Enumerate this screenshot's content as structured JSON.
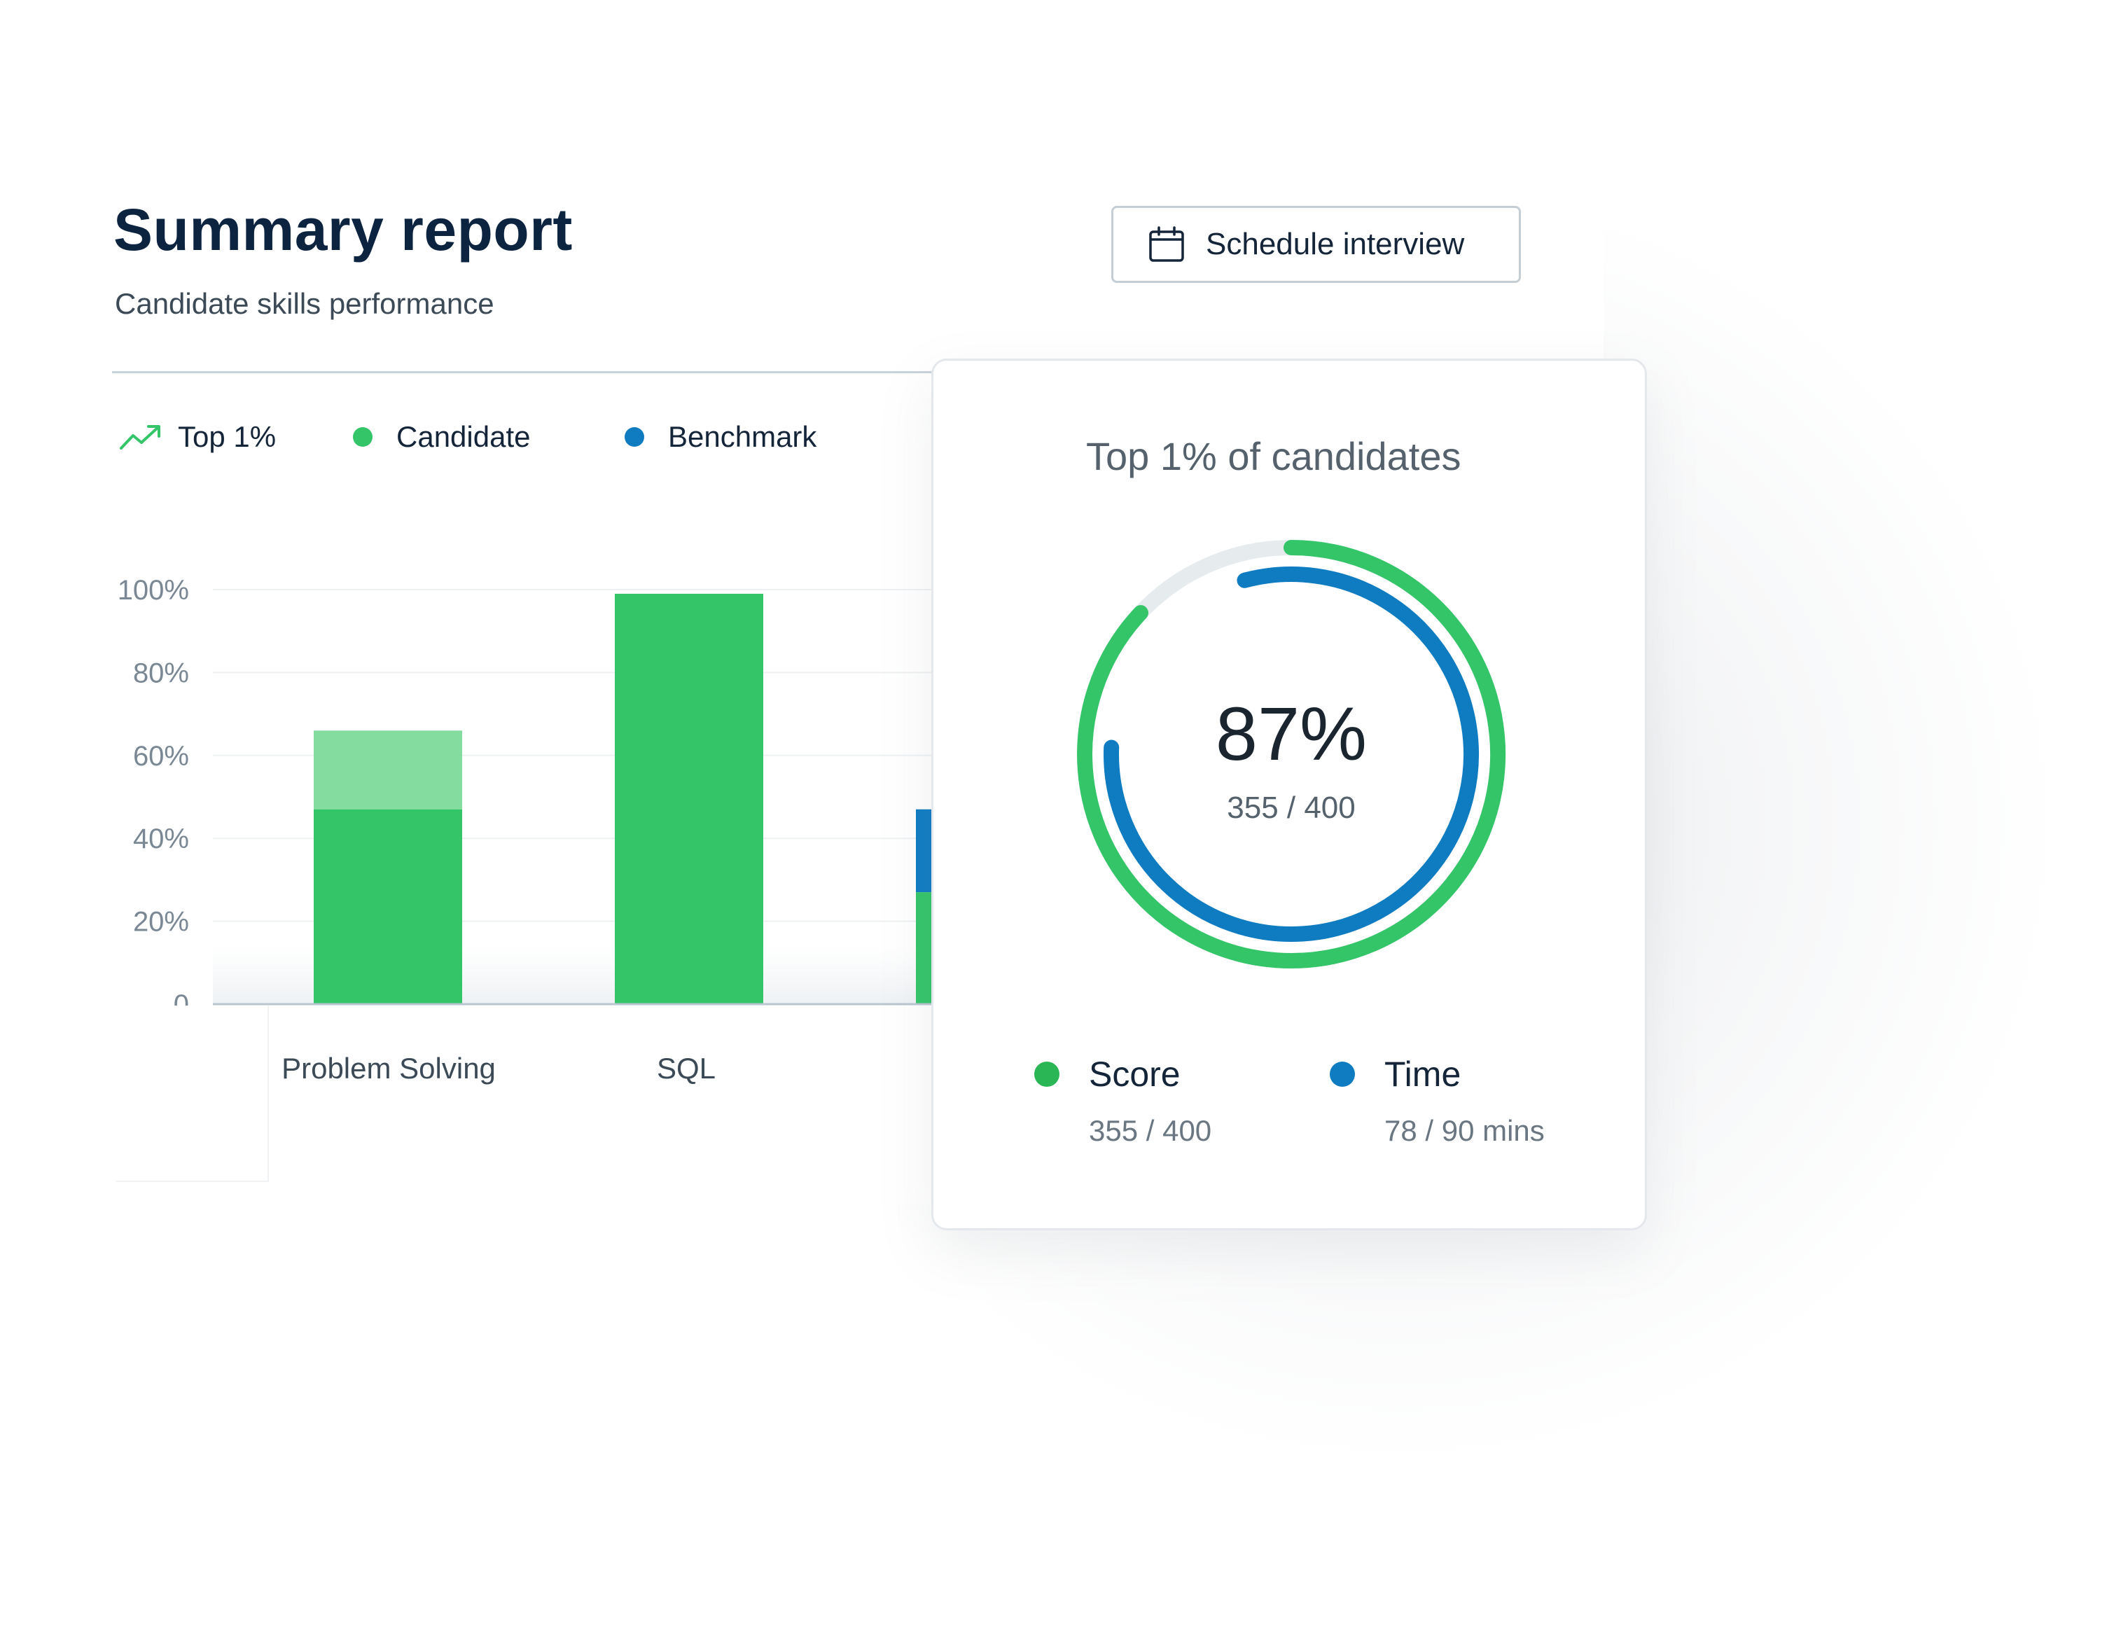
{
  "header": {
    "title": "Summary report",
    "subtitle": "Candidate skills performance",
    "schedule_button": "Schedule interview"
  },
  "legend": {
    "top_label": "Top 1%",
    "candidate_label": "Candidate",
    "benchmark_label": "Benchmark"
  },
  "colors": {
    "candidate": "#34c569",
    "candidate_light": "#84dd9f",
    "benchmark": "#0f7cc2",
    "track": "#e6ebee",
    "score_green": "#2bb656",
    "navy": "#0c2440"
  },
  "icons": {
    "trend": "trending-up-icon",
    "calendar": "calendar-icon"
  },
  "chart_data": {
    "type": "bar",
    "y_ticks": [
      "100%",
      "80%",
      "60%",
      "40%",
      "20%",
      "0"
    ],
    "ylim": [
      0,
      100
    ],
    "categories": [
      "Problem Solving",
      "SQL"
    ],
    "series": [
      {
        "name": "Candidate",
        "values": [
          47,
          99,
          27
        ]
      },
      {
        "name": "Benchmark",
        "values": [
          null,
          null,
          47
        ]
      }
    ],
    "problem_solving_light_top": 66,
    "grid": true
  },
  "score_card": {
    "title": "Top 1% of candidates",
    "percent": "87%",
    "fraction": "355 / 400",
    "score_progress": 0.87,
    "time_progress": 0.867,
    "score": {
      "label": "Score",
      "value": "355 / 400"
    },
    "time": {
      "label": "Time",
      "value": "78 / 90 mins"
    }
  }
}
